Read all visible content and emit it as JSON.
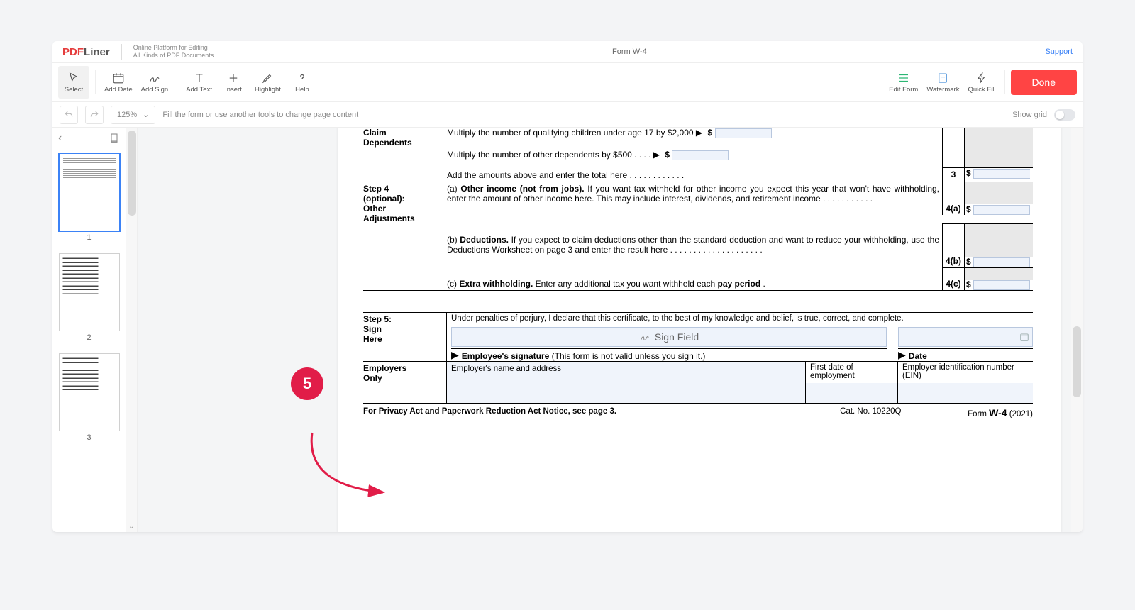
{
  "brand": {
    "line1": "Online Platform for Editing",
    "line2": "All Kinds of PDF Documents"
  },
  "header": {
    "title": "Form W-4",
    "support": "Support"
  },
  "toolbar": {
    "select": "Select",
    "addDate": "Add Date",
    "addSign": "Add Sign",
    "addText": "Add Text",
    "insert": "Insert",
    "highlight": "Highlight",
    "help": "Help",
    "editForm": "Edit Form",
    "watermark": "Watermark",
    "quickFill": "Quick Fill",
    "done": "Done"
  },
  "bar2": {
    "zoom": "125%",
    "hint": "Fill the form or use another tools to change page content",
    "showGrid": "Show grid"
  },
  "thumbs": {
    "p1": "1",
    "p2": "2",
    "p3": "3"
  },
  "callout": {
    "num": "5"
  },
  "doc": {
    "step3": {
      "label1": "Claim",
      "label2": "Dependents",
      "a": "Multiply the number of qualifying children under age 17 by $2,000 ▶",
      "b": "Multiply the number of other dependents by $500    .    .    .    .    ▶",
      "c": "Add the amounts above and enter the total here    .     .     .     .     .     .     .     .     .     .     .     .",
      "num3": "3",
      "d": "$",
      "d2": "$",
      "d3": "$"
    },
    "step4": {
      "label1": "Step 4",
      "label2": "(optional):",
      "label3": "Other",
      "label4": "Adjustments",
      "a_pre": "(a)  ",
      "a_b": "Other income (not from jobs).",
      "a_rest": " If you want tax withheld for other income you expect this year that won't have withholding, enter the amount of other income here. This may include interest, dividends, and retirement income     .      .      .      .      .      .      .      .      .      .      .",
      "a_num": "4(a)",
      "a_d": "$",
      "b_pre": "(b)  ",
      "b_b": "Deductions.",
      "b_rest": " If you expect to claim deductions other than the standard deduction and want to reduce your withholding, use the Deductions Worksheet on page 3 and enter the result here    .     .     .     .     .     .     .     .     .     .     .     .     .     .     .     .     .     .     .     .",
      "b_num": "4(b)",
      "b_d": "$",
      "c_pre": "(c)  ",
      "c_b": "Extra withholding.",
      "c_rest": " Enter any additional tax you want withheld each ",
      "c_b2": "pay period",
      "c_rest2": "    .",
      "c_num": "4(c)",
      "c_d": "$"
    },
    "step5": {
      "label1": "Step 5:",
      "label2": "Sign",
      "label3": "Here",
      "decl": "Under penalties of perjury, I declare that this certificate, to the best of my knowledge and belief, is true, correct, and complete.",
      "signField": "Sign Field",
      "sigLabel_b": "Employee's signature",
      "sigLabel_rest": " (This form is not valid unless you sign it.)",
      "dateLabel": "Date"
    },
    "emp": {
      "label1": "Employers",
      "label2": "Only",
      "c1": "Employer's name and address",
      "c2": "First date of employment",
      "c3": "Employer identification number (EIN)"
    },
    "footer": {
      "left": "For Privacy Act and Paperwork Reduction Act Notice, see page 3.",
      "mid": "Cat. No. 10220Q",
      "r1": "Form ",
      "r2": "W-4",
      "r3": " (2021)"
    }
  }
}
